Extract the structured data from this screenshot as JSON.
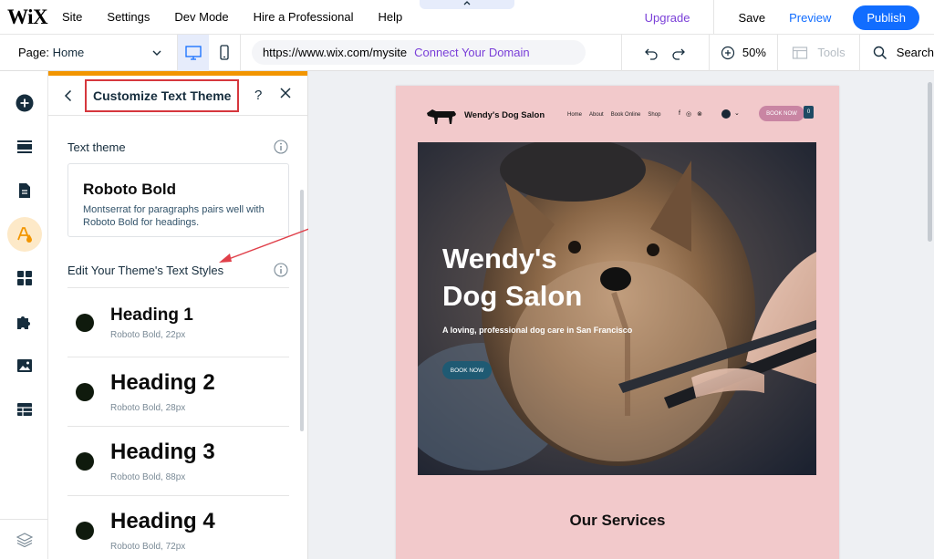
{
  "app": {
    "logo": "WiX",
    "menu": [
      "Site",
      "Settings",
      "Dev Mode",
      "Hire a Professional",
      "Help"
    ],
    "upgrade": "Upgrade",
    "save": "Save",
    "preview": "Preview",
    "publish": "Publish"
  },
  "toolbar": {
    "page_label": "Page:",
    "page_value": "Home",
    "url": "https://www.wix.com/mysite",
    "connect_domain": "Connect Your Domain",
    "zoom": "50%",
    "tools": "Tools",
    "search": "Search"
  },
  "panel": {
    "title": "Customize Text Theme",
    "help": "?",
    "text_theme_label": "Text theme",
    "theme_name": "Roboto Bold",
    "theme_description": "Montserrat for paragraphs pairs well with Roboto Bold for headings.",
    "edit_styles_label": "Edit Your Theme's Text Styles",
    "styles": [
      {
        "name": "Heading 1",
        "meta": "Roboto Bold, 22px"
      },
      {
        "name": "Heading 2",
        "meta": "Roboto Bold, 28px"
      },
      {
        "name": "Heading 3",
        "meta": "Roboto Bold, 88px"
      },
      {
        "name": "Heading 4",
        "meta": "Roboto Bold, 72px"
      }
    ]
  },
  "site": {
    "name": "Wendy's Dog Salon",
    "nav": [
      "Home",
      "About",
      "Book Online",
      "Shop"
    ],
    "social": [
      "f",
      "◎",
      "⊗"
    ],
    "book_button": "BOOK NOW",
    "cart_count": "0",
    "hero_line1": "Wendy's",
    "hero_line2": "Dog Salon",
    "hero_subtitle": "A loving, professional dog care in San Francisco",
    "hero_button": "BOOK NOW",
    "services_heading": "Our Services"
  },
  "colors": {
    "accent": "#116dff",
    "upgrade": "#7a3fd8",
    "panel_accent": "#f29500",
    "highlight": "#d6373d",
    "site_bg": "#f2c9cb"
  }
}
